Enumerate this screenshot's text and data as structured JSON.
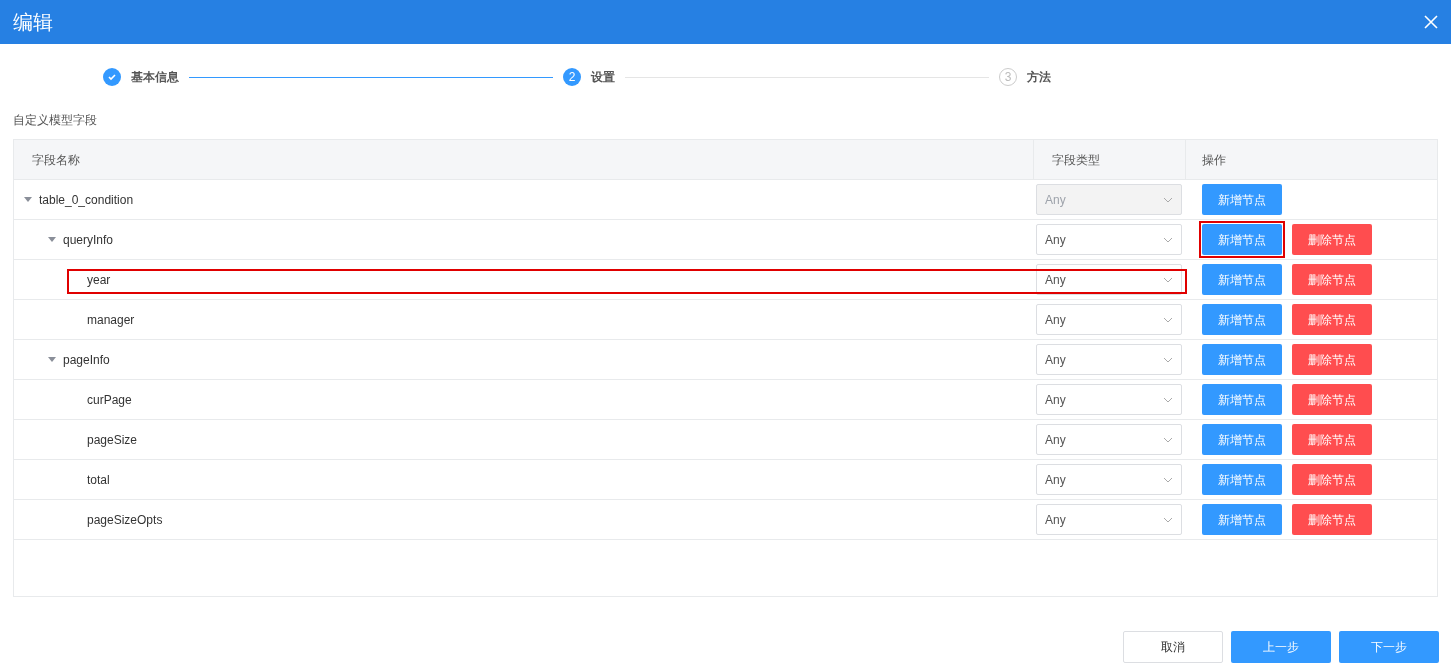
{
  "window": {
    "title": "编辑"
  },
  "steps": [
    {
      "label": "基本信息",
      "kind": "done"
    },
    {
      "number": "2",
      "label": "设置",
      "kind": "current"
    },
    {
      "number": "3",
      "label": "方法",
      "kind": "pending"
    }
  ],
  "section_label": "自定义模型字段",
  "table": {
    "columns": [
      "字段名称",
      "字段类型",
      "操作"
    ],
    "rows": [
      {
        "name": "table_0_condition",
        "type": "Any",
        "type_disabled": true,
        "expanded": true,
        "highlighted": false,
        "add_label": "新增节点",
        "add_highlighted": false,
        "children": [
          {
            "name": "queryInfo",
            "type": "Any",
            "type_disabled": false,
            "expanded": true,
            "highlighted": false,
            "add_label": "新增节点",
            "add_highlighted": true,
            "delete_label": "删除节点",
            "children": [
              {
                "name": "year",
                "type": "Any",
                "type_disabled": false,
                "highlighted": true,
                "add_label": "新增节点",
                "add_highlighted": false,
                "delete_label": "删除节点"
              },
              {
                "name": "manager",
                "type": "Any",
                "type_disabled": false,
                "highlighted": false,
                "add_label": "新增节点",
                "add_highlighted": false,
                "delete_label": "删除节点"
              }
            ]
          },
          {
            "name": "pageInfo",
            "type": "Any",
            "type_disabled": false,
            "expanded": true,
            "highlighted": false,
            "add_label": "新增节点",
            "add_highlighted": false,
            "delete_label": "删除节点",
            "children": [
              {
                "name": "curPage",
                "type": "Any",
                "type_disabled": false,
                "highlighted": false,
                "add_label": "新增节点",
                "add_highlighted": false,
                "delete_label": "删除节点"
              },
              {
                "name": "pageSize",
                "type": "Any",
                "type_disabled": false,
                "highlighted": false,
                "add_label": "新增节点",
                "add_highlighted": false,
                "delete_label": "删除节点"
              },
              {
                "name": "total",
                "type": "Any",
                "type_disabled": false,
                "highlighted": false,
                "add_label": "新增节点",
                "add_highlighted": false,
                "delete_label": "删除节点"
              },
              {
                "name": "pageSizeOpts",
                "type": "Any",
                "type_disabled": false,
                "highlighted": false,
                "add_label": "新增节点",
                "add_highlighted": false,
                "delete_label": "删除节点"
              }
            ]
          }
        ]
      }
    ]
  },
  "buttons": [
    {
      "label": "取消",
      "kind": "secondary"
    },
    {
      "label": "上一步",
      "kind": "primary"
    },
    {
      "label": "下一步",
      "kind": "primary"
    }
  ]
}
